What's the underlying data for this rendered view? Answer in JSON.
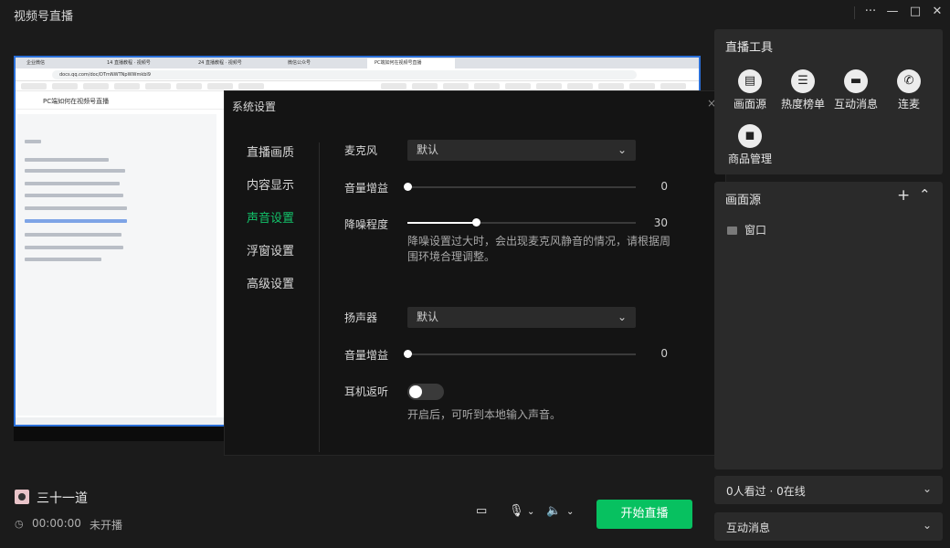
{
  "app": {
    "title": "视频号直播"
  },
  "window_controls": {
    "more": "···",
    "minimize": "—",
    "maximize": "□",
    "close": "✕"
  },
  "preview": {
    "browser_tabs": [
      "企业微信",
      "14 直播教程 · 视频号",
      "24 直播教程 · 视频号",
      "微信公众号",
      "PC端如何在视频号直播"
    ],
    "address": "docs.qq.com/doc/DTmNWTNpWWmkbl9",
    "doc_title": "PC端如何在视频号直播"
  },
  "settings": {
    "title": "系统设置",
    "close": "×",
    "nav": [
      {
        "label": "直播画质"
      },
      {
        "label": "内容显示"
      },
      {
        "label": "声音设置"
      },
      {
        "label": "浮窗设置"
      },
      {
        "label": "高级设置"
      }
    ],
    "microphone": {
      "label": "麦克风",
      "value": "默认"
    },
    "mic_gain": {
      "label": "音量增益",
      "value": "0",
      "level": 0
    },
    "noise_reduction": {
      "label": "降噪程度",
      "value": "30",
      "level": 30,
      "hint": "降噪设置过大时，会出现麦克风静音的情况，请根据周围环境合理调整。"
    },
    "speaker": {
      "label": "扬声器",
      "value": "默认"
    },
    "speaker_gain": {
      "label": "音量增益",
      "value": "0",
      "level": 0
    },
    "earback": {
      "label": "耳机返听",
      "enabled": false,
      "hint": "开启后，可听到本地输入声音。"
    }
  },
  "right_panel": {
    "tools_title": "直播工具",
    "tools": [
      {
        "label": "画面源",
        "icon": "document-icon"
      },
      {
        "label": "热度榜单",
        "icon": "list-icon"
      },
      {
        "label": "互动消息",
        "icon": "chat-icon"
      },
      {
        "label": "连麦",
        "icon": "phone-icon"
      },
      {
        "label": "商品管理",
        "icon": "bag-icon"
      }
    ],
    "sources_title": "画面源",
    "sources": [
      {
        "label": "窗口"
      }
    ],
    "viewers": "0人看过 · 0在线",
    "interaction": "互动消息"
  },
  "bottom": {
    "user_name": "三十一道",
    "time": "00:00:00",
    "status": "未开播",
    "start_button": "开始直播"
  },
  "colors": {
    "accent": "#07c160",
    "nav_active": "#13c26a"
  }
}
